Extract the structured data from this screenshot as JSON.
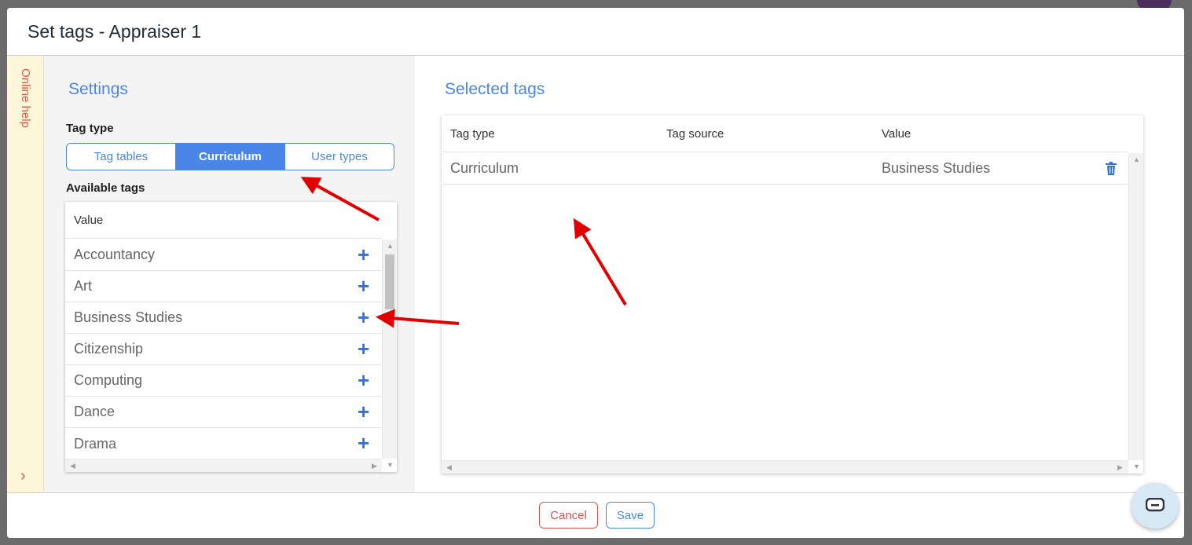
{
  "dialog": {
    "title": "Set tags - Appraiser 1"
  },
  "online_help": {
    "label": "Online help",
    "chevron": "›"
  },
  "settings": {
    "title": "Settings",
    "tag_type_label": "Tag type",
    "tag_type_options": [
      {
        "label": "Tag tables",
        "active": false
      },
      {
        "label": "Curriculum",
        "active": true
      },
      {
        "label": "User types",
        "active": false
      }
    ],
    "available_tags_label": "Available tags",
    "available_tags": {
      "column_header": "Value",
      "rows": [
        "Accountancy",
        "Art",
        "Business Studies",
        "Citizenship",
        "Computing",
        "Dance",
        "Drama"
      ],
      "row_action_icon": "plus-icon"
    }
  },
  "selected": {
    "title": "Selected tags",
    "columns": [
      "Tag type",
      "Tag source",
      "Value"
    ],
    "rows": [
      {
        "tag_type": "Curriculum",
        "tag_source": "",
        "value": "Business Studies",
        "action_icon": "trash-icon"
      }
    ]
  },
  "footer": {
    "cancel_label": "Cancel",
    "save_label": "Save"
  },
  "colors": {
    "accent": "#4a86e8",
    "cancel": "#d9534f",
    "arrow": "#e00000",
    "help_bg": "#fdf6d8"
  }
}
